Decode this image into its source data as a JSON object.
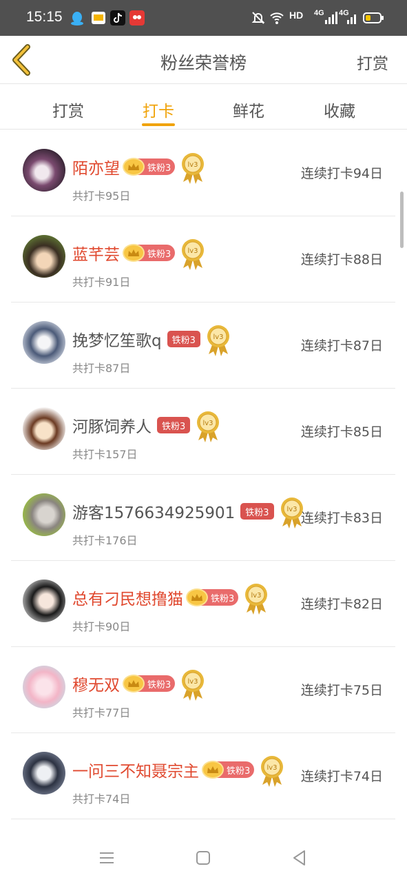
{
  "status_bar": {
    "time": "15:15",
    "network": "HD",
    "signal1": "4G",
    "signal2": "4G",
    "icons": [
      "qq-icon",
      "video-app-icon",
      "tiktok-icon",
      "red-app-icon",
      "bell-off-icon",
      "wifi-icon",
      "battery-icon"
    ]
  },
  "header": {
    "title": "粉丝荣誉榜",
    "action": "打赏"
  },
  "tabs": [
    {
      "label": "打赏",
      "active": false
    },
    {
      "label": "打卡",
      "active": true
    },
    {
      "label": "鲜花",
      "active": false
    },
    {
      "label": "收藏",
      "active": false
    }
  ],
  "list": [
    {
      "name": "陌亦望",
      "badge": "铁粉3",
      "level": "lv3",
      "total": "共打卡95日",
      "streak": "连续打卡94日"
    },
    {
      "name": "蓝芊芸",
      "badge": "铁粉3",
      "level": "lv3",
      "total": "共打卡91日",
      "streak": "连续打卡88日"
    },
    {
      "name": "挽梦忆笙歌q",
      "badge": "铁粉3",
      "level": "lv3",
      "total": "共打卡87日",
      "streak": "连续打卡87日"
    },
    {
      "name": "河豚饲养人",
      "badge": "铁粉3",
      "level": "lv3",
      "total": "共打卡157日",
      "streak": "连续打卡85日"
    },
    {
      "name": "游客1576634925901",
      "badge": "铁粉3",
      "level": "lv3",
      "total": "共打卡176日",
      "streak": "连续打卡83日"
    },
    {
      "name": "总有刁民想撸猫",
      "badge": "铁粉3",
      "level": "lv3",
      "total": "共打卡90日",
      "streak": "连续打卡82日"
    },
    {
      "name": "穆无双",
      "badge": "铁粉3",
      "level": "lv3",
      "total": "共打卡77日",
      "streak": "连续打卡75日"
    },
    {
      "name": "一问三不知聂宗主",
      "badge": "铁粉3",
      "level": "lv3",
      "total": "共打卡74日",
      "streak": "连续打卡74日"
    }
  ],
  "colors": {
    "accent": "#f0a30a",
    "vip_name": "#e0492f",
    "badge": "#d9534f"
  }
}
